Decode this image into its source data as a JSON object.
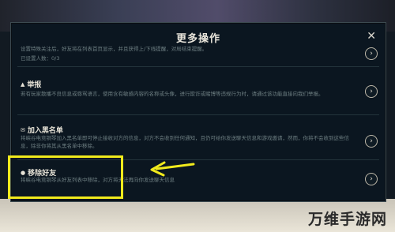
{
  "dialog": {
    "title": "更多操作",
    "close_glyph": "✕"
  },
  "sections": [
    {
      "title": "",
      "description": "设置特殊关注后，好友将在列表首页显示，并且获得上/下线提醒，对局结束提醒。",
      "description2": "已设置人数：0/3"
    },
    {
      "title": "举报",
      "icon": "warning-icon",
      "description": "若有玩家散播不良信息或辱骂语言，使用含有敏感内容的名称或头像，进行欺诈或赌博等违规行为时，请通过该功能直接向我们举报。"
    },
    {
      "title": "加入黑名单",
      "icon": "block-user-icon",
      "description": "将峡谷电竞铜琴加入黑名单即可停止接收对方的信息，对方不会收到任何通知，且仍可给你发送聊天信息和游戏邀请，然而，你将不会收到这些信息，除非你将其从黑名单中移除。"
    },
    {
      "title": "移除好友",
      "icon": "remove-friend-icon",
      "description": "将峡谷电竞铜琴从好友列表中移除，对方将无法再向你发送聊天信息"
    }
  ],
  "chevron_glyph": "›",
  "annotation": {
    "highlight_color": "#f1ea1c",
    "arrow_color": "#f1ea1c"
  },
  "watermark": "万维手游网"
}
